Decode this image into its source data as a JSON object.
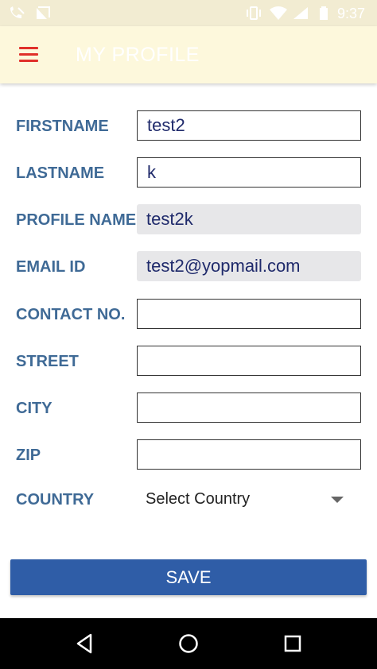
{
  "status_bar": {
    "time": "9:37",
    "icons": [
      "wifi-calling-icon",
      "no-signal-icon",
      "vibrate-icon",
      "wifi-icon",
      "cell-signal-icon",
      "battery-icon"
    ]
  },
  "app_bar": {
    "menu_icon": "hamburger-menu-icon",
    "title": "MY PROFILE"
  },
  "form": {
    "firstname": {
      "label": "FIRSTNAME",
      "value": "test2"
    },
    "lastname": {
      "label": "LASTNAME",
      "value": "k"
    },
    "profile_name": {
      "label": "PROFILE NAME",
      "value": "test2k"
    },
    "email": {
      "label": "EMAIL ID",
      "value": "test2@yopmail.com"
    },
    "contact": {
      "label": "CONTACT NO.",
      "value": ""
    },
    "street": {
      "label": "STREET",
      "value": ""
    },
    "city": {
      "label": "CITY",
      "value": ""
    },
    "zip": {
      "label": "ZIP",
      "value": ""
    },
    "country": {
      "label": "COUNTRY",
      "selected": "Select Country"
    }
  },
  "save_label": "SAVE",
  "nav_bar": {
    "icons": [
      "back-icon",
      "home-icon",
      "recents-icon"
    ]
  },
  "colors": {
    "label": "#3f6a96",
    "input_text": "#1f2a6b",
    "accent": "#2f5da7",
    "menu_icon": "#e0302a",
    "app_bar_bg": "#fdf8dc"
  }
}
